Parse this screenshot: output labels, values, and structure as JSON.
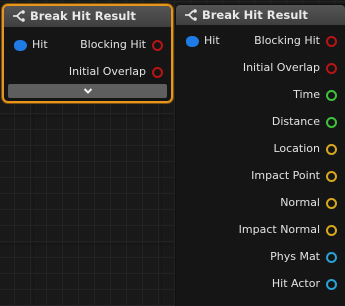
{
  "nodes": [
    {
      "title": "Break Hit Result",
      "inputs": [
        {
          "label": "Hit",
          "color": "#1f7be6"
        }
      ],
      "outputs": [
        {
          "label": "Blocking Hit",
          "color": "#b81414"
        },
        {
          "label": "Initial Overlap",
          "color": "#b81414"
        }
      ],
      "advanced_toggle": "chevron-down-icon",
      "selected": true
    },
    {
      "title": "Break Hit Result",
      "inputs": [
        {
          "label": "Hit",
          "color": "#1f7be6"
        }
      ],
      "outputs": [
        {
          "label": "Blocking Hit",
          "color": "#b81414"
        },
        {
          "label": "Initial Overlap",
          "color": "#b81414"
        },
        {
          "label": "Time",
          "color": "#3fc23a"
        },
        {
          "label": "Distance",
          "color": "#3fc23a"
        },
        {
          "label": "Location",
          "color": "#d6a81c"
        },
        {
          "label": "Impact Point",
          "color": "#d6a81c"
        },
        {
          "label": "Normal",
          "color": "#d6a81c"
        },
        {
          "label": "Impact Normal",
          "color": "#d6a81c"
        },
        {
          "label": "Phys Mat",
          "color": "#2aa2d6"
        },
        {
          "label": "Hit Actor",
          "color": "#2aa2d6"
        }
      ],
      "selected": false
    }
  ]
}
